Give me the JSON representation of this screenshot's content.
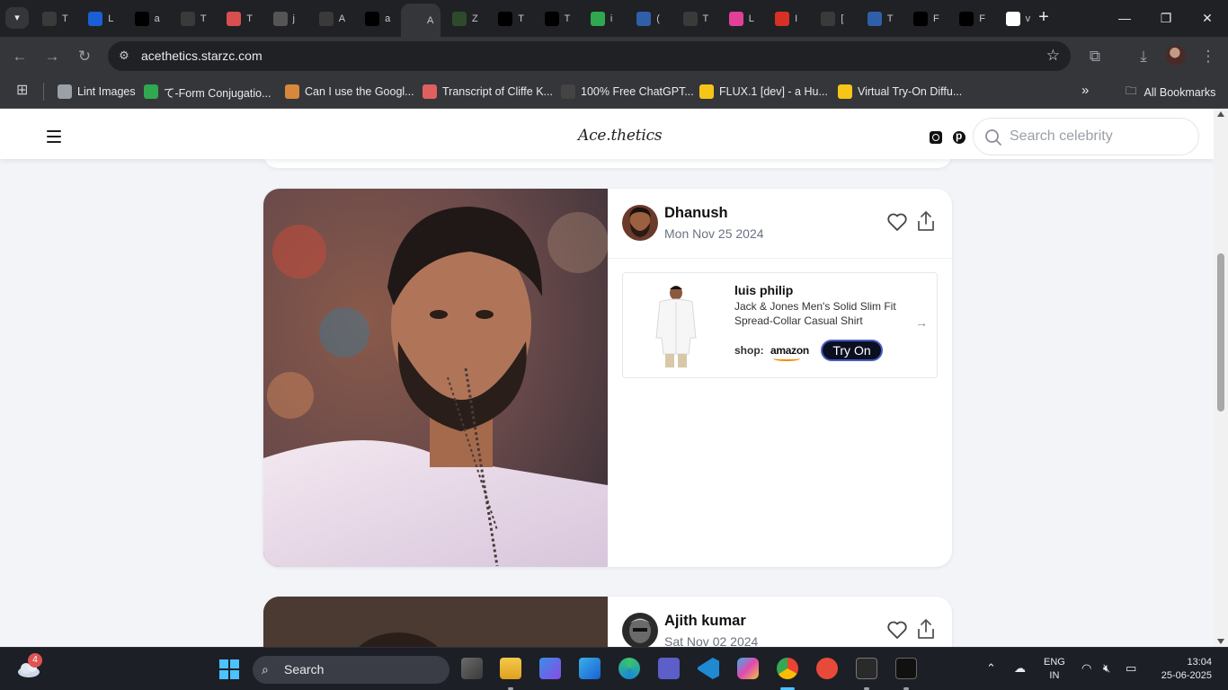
{
  "browser": {
    "tabs": [
      {
        "label": "T",
        "icon": "vk-icon",
        "color": "#3a3a3a"
      },
      {
        "label": "L",
        "icon": "info-i-icon",
        "color": "#1a5fd6"
      },
      {
        "label": "a",
        "icon": "triangle-a-icon",
        "color": "#000000"
      },
      {
        "label": "T",
        "icon": "ph-icon",
        "color": "#3a3a3a"
      },
      {
        "label": "T",
        "icon": "document-icon",
        "color": "#d94f4f"
      },
      {
        "label": "j",
        "icon": "spiral-icon",
        "color": "#555555"
      },
      {
        "label": "A",
        "icon": "octopus-icon",
        "color": "#3a3a3a"
      },
      {
        "label": "a",
        "icon": "triangle-a-icon",
        "color": "#000000"
      },
      {
        "label": "A",
        "icon": "site-icon",
        "color": "#35363a",
        "active": true
      },
      {
        "label": "Z",
        "icon": "ek-icon",
        "color": "#2d4a2d"
      },
      {
        "label": "T",
        "icon": "github-icon",
        "color": "#000000"
      },
      {
        "label": "T",
        "icon": "openai-icon",
        "color": "#000000"
      },
      {
        "label": "i",
        "icon": "green-box-icon",
        "color": "#2fa84f"
      },
      {
        "label": "(",
        "icon": "avatar-icon",
        "color": "#2f5fa8"
      },
      {
        "label": "T",
        "icon": "bank-icon",
        "color": "#3a3a3a"
      },
      {
        "label": "L",
        "icon": "colorful-icon",
        "color": "#e0409a"
      },
      {
        "label": "I",
        "icon": "gmail-icon",
        "color": "#d93025"
      },
      {
        "label": "[",
        "icon": "spiral-green-icon",
        "color": "#3a3a3a"
      },
      {
        "label": "T",
        "icon": "avatar-icon",
        "color": "#2f5fa8"
      },
      {
        "label": "F",
        "icon": "gf-icon",
        "color": "#000000"
      },
      {
        "label": "F",
        "icon": "gf-icon",
        "color": "#000000"
      },
      {
        "label": "v",
        "icon": "google-icon",
        "color": "#ffffff"
      }
    ],
    "url": "acethetics.starzc.com",
    "bookmarks": [
      {
        "label": "Lint Images",
        "icon": "globe-icon",
        "color": "#9aa0a6"
      },
      {
        "label": "て-Form Conjugatio...",
        "icon": "te-icon",
        "color": "#2fa84f"
      },
      {
        "label": "Can I use the Googl...",
        "icon": "person-icon",
        "color": "#d9873a"
      },
      {
        "label": "Transcript of Cliffe K...",
        "icon": "doc-icon",
        "color": "#e06060"
      },
      {
        "label": "100% Free ChatGPT...",
        "icon": "ph-icon",
        "color": "#444444"
      },
      {
        "label": "FLUX.1 [dev] - a Hu...",
        "icon": "hf-icon",
        "color": "#f5c518"
      },
      {
        "label": "Virtual Try-On Diffu...",
        "icon": "hf-icon",
        "color": "#f5c518"
      }
    ],
    "all_bookmarks_label": "All Bookmarks"
  },
  "site": {
    "logo": "Ace.thetics",
    "search_placeholder": "Search celebrity",
    "posts": [
      {
        "name": "Dhanush",
        "date": "Mon Nov 25 2024",
        "product": {
          "brand": "luis philip",
          "description": "Jack & Jones Men's Solid Slim Fit Spread-Collar Casual Shirt",
          "shop_label": "shop:",
          "store": "amazon",
          "try_on_label": "Try On"
        }
      },
      {
        "name": "Ajith kumar",
        "date": "Sat Nov 02 2024"
      }
    ]
  },
  "taskbar": {
    "notification_count": "4",
    "search_label": "Search",
    "language": "ENG",
    "region": "IN",
    "time": "13:04",
    "date": "25-06-2025"
  }
}
